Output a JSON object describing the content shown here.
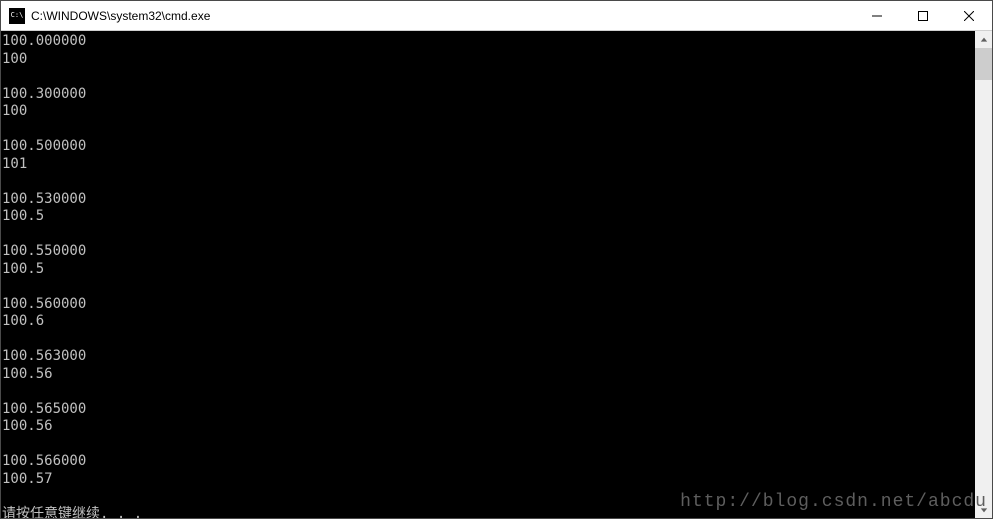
{
  "window": {
    "title": "C:\\WINDOWS\\system32\\cmd.exe"
  },
  "console": {
    "lines": [
      "100.000000",
      "100",
      "",
      "100.300000",
      "100",
      "",
      "100.500000",
      "101",
      "",
      "100.530000",
      "100.5",
      "",
      "100.550000",
      "100.5",
      "",
      "100.560000",
      "100.6",
      "",
      "100.563000",
      "100.56",
      "",
      "100.565000",
      "100.56",
      "",
      "100.566000",
      "100.57",
      "",
      "请按任意键继续. . ."
    ]
  },
  "watermark": "http://blog.csdn.net/abcdu"
}
